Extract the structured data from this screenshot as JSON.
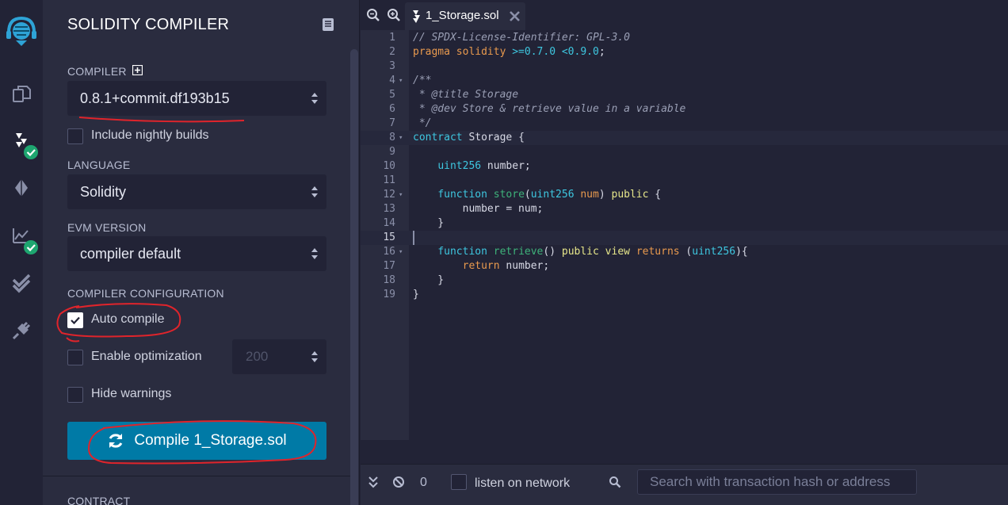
{
  "panel": {
    "title": "SOLIDITY COMPILER",
    "compiler_label": "COMPILER",
    "compiler_value": "0.8.1+commit.df193b15",
    "nightly_label": "Include nightly builds",
    "language_label": "LANGUAGE",
    "language_value": "Solidity",
    "evm_label": "EVM VERSION",
    "evm_value": "compiler default",
    "config_label": "COMPILER CONFIGURATION",
    "auto_compile_label": "Auto compile",
    "auto_compile_checked": true,
    "optimization_label": "Enable optimization",
    "optimization_runs": "200",
    "hide_warnings_label": "Hide warnings",
    "compile_button": "Compile 1_Storage.sol",
    "contract_label": "CONTRACT"
  },
  "editor": {
    "tab_label": "1_Storage.sol",
    "active_line": 15
  },
  "terminal": {
    "pending_count": "0",
    "listen_label": "listen on network",
    "search_placeholder": "Search with transaction hash or address"
  },
  "colors": {
    "accent_button": "#007aa6",
    "check_badge": "#1ea670",
    "annotation_red": "#e0242b"
  },
  "icons": [
    "remix-logo-icon",
    "file-explorer-icon",
    "solidity-compiler-icon",
    "deploy-run-icon",
    "analysis-icon",
    "test-icon",
    "plugin-icon",
    "documentation-icon",
    "zoom-out-icon",
    "zoom-in-icon",
    "close-icon",
    "chevron-down-icon",
    "block-icon",
    "search-icon"
  ]
}
